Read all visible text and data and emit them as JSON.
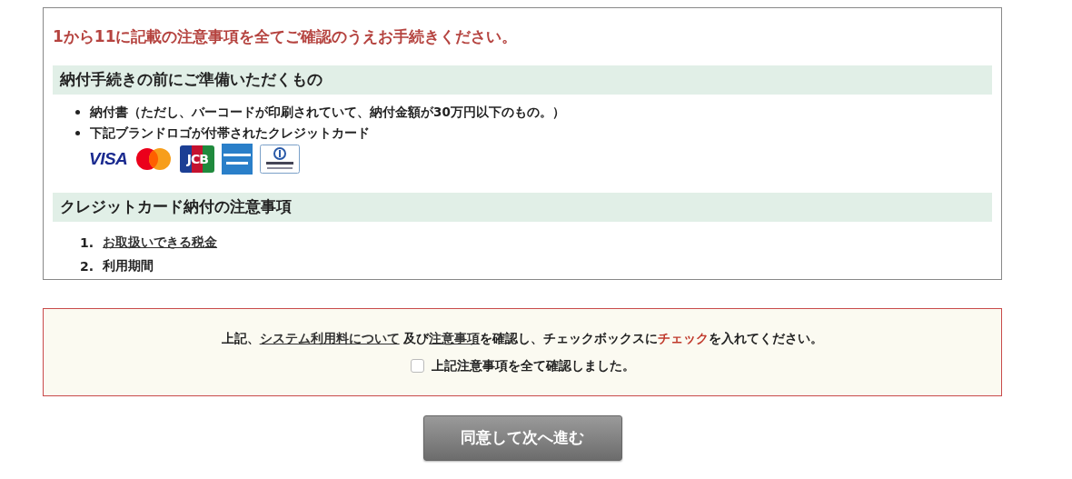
{
  "notice_title": "1から11に記載の注意事項を全てご確認のうえお手続きください。",
  "preparation": {
    "heading": "納付手続きの前にご準備いただくもの",
    "items": [
      "納付書（ただし、バーコードが印刷されていて、納付金額が30万円以下のもの。）",
      "下記ブランドロゴが付帯されたクレジットカード"
    ],
    "card_logos": [
      {
        "kind": "visa",
        "text": "VISA"
      },
      {
        "kind": "mastercard"
      },
      {
        "kind": "jcb",
        "text": "JCB"
      },
      {
        "kind": "amex"
      },
      {
        "kind": "diners"
      }
    ]
  },
  "cautions": {
    "heading": "クレジットカード納付の注意事項",
    "items": [
      {
        "number": "1.",
        "label": "お取扱いできる税金",
        "link": true
      },
      {
        "number": "2.",
        "label": "利用期間",
        "link": false
      }
    ]
  },
  "confirm": {
    "instruction": [
      {
        "kind": "plain",
        "text": "上記、"
      },
      {
        "kind": "link",
        "text": "システム利用料について"
      },
      {
        "kind": "plain",
        "text": " 及び"
      },
      {
        "kind": "link",
        "text": "注意事項"
      },
      {
        "kind": "plain",
        "text": "を確認し、チェックボックスに"
      },
      {
        "kind": "emphasis",
        "text": "チェック"
      },
      {
        "kind": "plain",
        "text": "を入れてください。"
      }
    ],
    "checkbox": {
      "label": "上記注意事項を全て確認しました。",
      "checked": false
    }
  },
  "submit_button": "同意して次へ進む"
}
